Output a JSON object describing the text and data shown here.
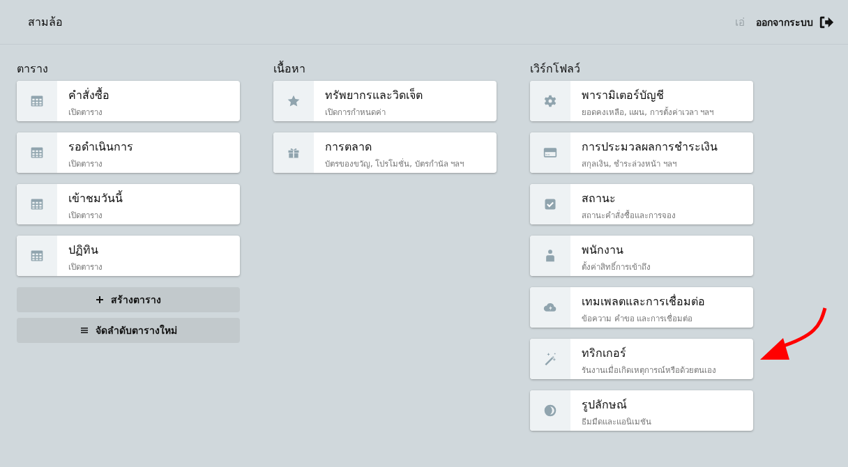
{
  "header": {
    "title": "สามล้อ",
    "user_label": "เอ่",
    "logout": "ออกจากระบบ"
  },
  "sections": [
    {
      "title": "ตาราง",
      "cards": [
        {
          "kind": "table",
          "title": "คำสั่งซื้อ",
          "subtitle": "เปิดตาราง"
        },
        {
          "kind": "table",
          "title": "รอดำเนินการ",
          "subtitle": "เปิดตาราง"
        },
        {
          "kind": "table",
          "title": "เข้าชมวันนี้",
          "subtitle": "เปิดตาราง"
        },
        {
          "kind": "table",
          "title": "ปฏิทิน",
          "subtitle": "เปิดตาราง"
        }
      ],
      "buttons": [
        {
          "kind": "create",
          "label": "สร้างตาราง"
        },
        {
          "kind": "reorder",
          "label": "จัดลำดับตารางใหม่"
        }
      ]
    },
    {
      "title": "เนื้อหา",
      "cards": [
        {
          "kind": "resources",
          "title": "ทรัพยากรและวิดเจ็ต",
          "subtitle": "เปิดการกำหนดค่า"
        },
        {
          "kind": "marketing",
          "title": "การตลาด",
          "subtitle": "บัตรของขวัญ, โปรโมชั่น, บัตรกำนัล ฯลฯ"
        }
      ]
    },
    {
      "title": "เวิร์กโฟลว์",
      "cards": [
        {
          "kind": "settings",
          "title": "พารามิเตอร์บัญชี",
          "subtitle": "ยอดคงเหลือ, แผน, การตั้งค่าเวลา ฯลฯ"
        },
        {
          "kind": "payments",
          "title": "การประมวลผลการชำระเงิน",
          "subtitle": "สกุลเงิน, ชำระล่วงหน้า ฯลฯ"
        },
        {
          "kind": "statuses",
          "title": "สถานะ",
          "subtitle": "สถานะคำสั่งซื้อและการจอง"
        },
        {
          "kind": "staff",
          "title": "พนักงาน",
          "subtitle": "ตั้งค่าสิทธิ์การเข้าถึง"
        },
        {
          "kind": "integrations",
          "title": "เทมเพลตและการเชื่อมต่อ",
          "subtitle": "ข้อความ คำขอ และการเชื่อมต่อ"
        },
        {
          "kind": "triggers",
          "title": "ทริกเกอร์",
          "subtitle": "รันงานเมื่อเกิดเหตุการณ์หรือด้วยตนเอง"
        },
        {
          "kind": "appearance",
          "title": "รูปลักษณ์",
          "subtitle": "ธีมมืดและแอนิเมชัน"
        }
      ]
    }
  ],
  "callout": {
    "kind": "arrow"
  }
}
